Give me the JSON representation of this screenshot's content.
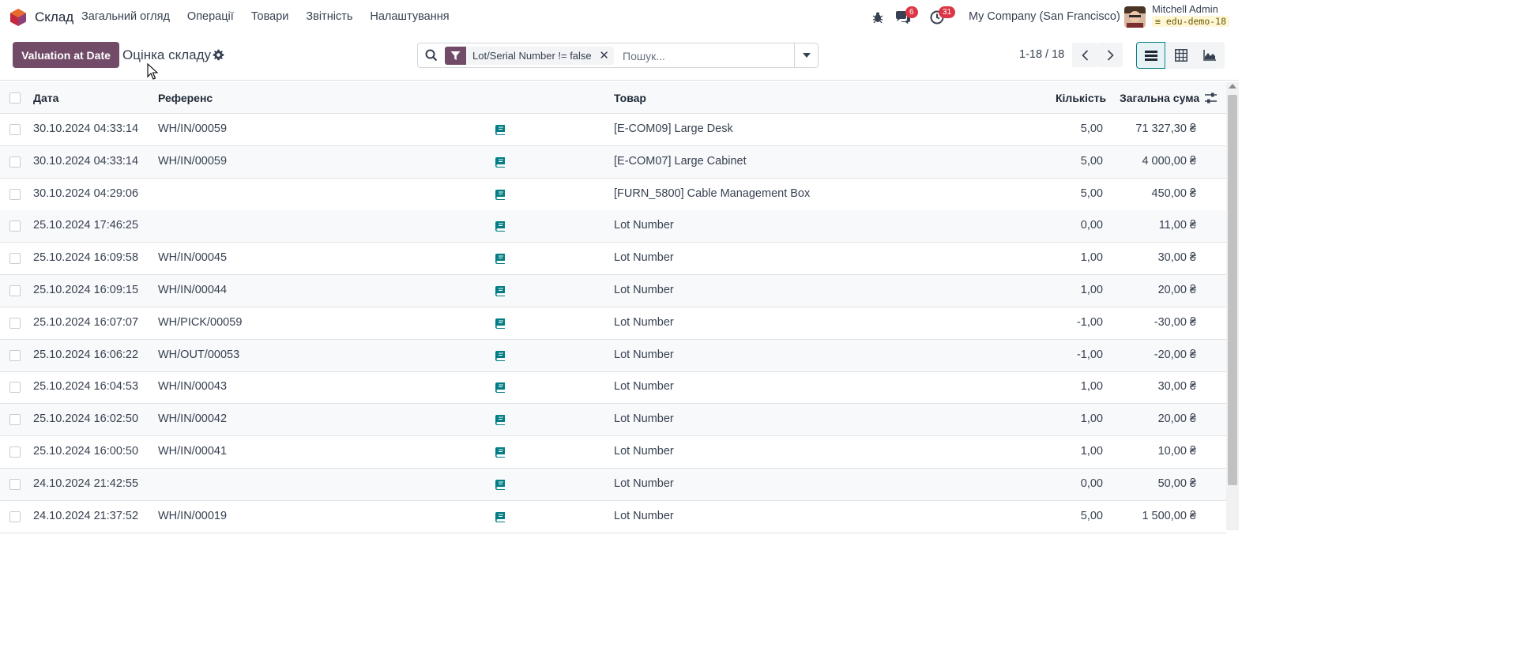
{
  "app": {
    "name": "Склад",
    "logo_icon": "odoo-logo-icon"
  },
  "menu": [
    "Загальний огляд",
    "Операції",
    "Товари",
    "Звітність",
    "Налаштування"
  ],
  "systray": {
    "chat_badge": "6",
    "activity_badge": "31",
    "company": "My Company (San Francisco)",
    "user_name": "Mitchell Admin",
    "database": "edu-demo-18"
  },
  "control": {
    "primary_button": "Valuation at Date",
    "title": "Оцінка складу",
    "search": {
      "facet": "Lot/Serial Number != false",
      "placeholder": "Пошук..."
    },
    "pager": "1-18 / 18"
  },
  "table": {
    "headers": {
      "date": "Дата",
      "reference": "Референс",
      "product": "Товар",
      "quantity": "Кількість",
      "total": "Загальна сума"
    },
    "rows": [
      {
        "date": "30.10.2024 04:33:14",
        "reference": "WH/IN/00059",
        "product": "[E-COM09] Large Desk",
        "quantity": "5,00",
        "total": "71 327,30 ₴"
      },
      {
        "date": "30.10.2024 04:33:14",
        "reference": "WH/IN/00059",
        "product": "[E-COM07] Large Cabinet",
        "quantity": "5,00",
        "total": "4 000,00 ₴"
      },
      {
        "date": "30.10.2024 04:29:06",
        "reference": "",
        "product": "[FURN_5800] Cable Management Box",
        "quantity": "5,00",
        "total": "450,00 ₴"
      },
      {
        "date": "25.10.2024 17:46:25",
        "reference": "",
        "product": "Lot Number",
        "quantity": "0,00",
        "total": "11,00 ₴"
      },
      {
        "date": "25.10.2024 16:09:58",
        "reference": "WH/IN/00045",
        "product": "Lot Number",
        "quantity": "1,00",
        "total": "30,00 ₴"
      },
      {
        "date": "25.10.2024 16:09:15",
        "reference": "WH/IN/00044",
        "product": "Lot Number",
        "quantity": "1,00",
        "total": "20,00 ₴"
      },
      {
        "date": "25.10.2024 16:07:07",
        "reference": "WH/PICK/00059",
        "product": "Lot Number",
        "quantity": "-1,00",
        "total": "-30,00 ₴"
      },
      {
        "date": "25.10.2024 16:06:22",
        "reference": "WH/OUT/00053",
        "product": "Lot Number",
        "quantity": "-1,00",
        "total": "-20,00 ₴"
      },
      {
        "date": "25.10.2024 16:04:53",
        "reference": "WH/IN/00043",
        "product": "Lot Number",
        "quantity": "1,00",
        "total": "30,00 ₴"
      },
      {
        "date": "25.10.2024 16:02:50",
        "reference": "WH/IN/00042",
        "product": "Lot Number",
        "quantity": "1,00",
        "total": "20,00 ₴"
      },
      {
        "date": "25.10.2024 16:00:50",
        "reference": "WH/IN/00041",
        "product": "Lot Number",
        "quantity": "1,00",
        "total": "10,00 ₴"
      },
      {
        "date": "24.10.2024 21:42:55",
        "reference": "",
        "product": "Lot Number",
        "quantity": "0,00",
        "total": "50,00 ₴"
      },
      {
        "date": "24.10.2024 21:37:52",
        "reference": "WH/IN/00019",
        "product": "Lot Number",
        "quantity": "5,00",
        "total": "1 500,00 ₴"
      }
    ]
  },
  "colors": {
    "primary": "#714b67",
    "teal": "#017e84",
    "badge": "#dc3545"
  }
}
